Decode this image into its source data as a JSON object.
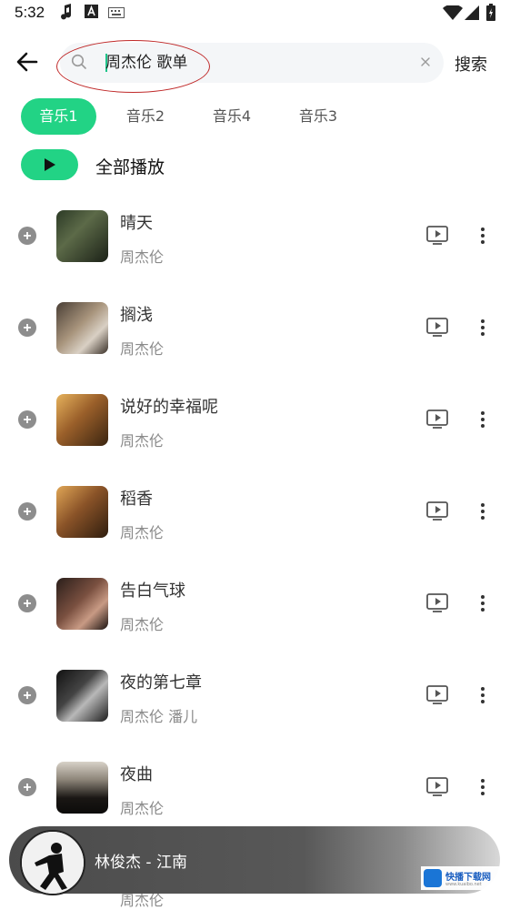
{
  "status_bar": {
    "time": "5:32",
    "icons": [
      "music-note-icon",
      "text-a-icon",
      "keyboard-icon",
      "wifi-icon",
      "signal-icon",
      "battery-charging-icon"
    ]
  },
  "header": {
    "search_value": "周杰伦 歌单",
    "search_button": "搜索",
    "annotation_color": "#c02a2a"
  },
  "tabs": [
    {
      "label": "音乐1",
      "active": true
    },
    {
      "label": "音乐2",
      "active": false
    },
    {
      "label": "音乐4",
      "active": false
    },
    {
      "label": "音乐3",
      "active": false
    }
  ],
  "play_all": {
    "label": "全部播放"
  },
  "songs": [
    {
      "title": "晴天",
      "artist": "周杰伦"
    },
    {
      "title": "搁浅",
      "artist": "周杰伦"
    },
    {
      "title": "说好的幸福呢",
      "artist": "周杰伦"
    },
    {
      "title": "稻香",
      "artist": "周杰伦"
    },
    {
      "title": "告白气球",
      "artist": "周杰伦"
    },
    {
      "title": "夜的第七章",
      "artist": "周杰伦 潘儿"
    },
    {
      "title": "夜曲",
      "artist": "周杰伦"
    },
    {
      "title": "",
      "artist": "周杰伦"
    }
  ],
  "now_playing": {
    "title": "林俊杰 - 江南"
  },
  "watermark": {
    "name": "快播下载网",
    "sub": "www.kuaibo.net"
  },
  "colors": {
    "accent": "#22d385",
    "text": "#333333",
    "subtext": "#8a8a8a"
  }
}
